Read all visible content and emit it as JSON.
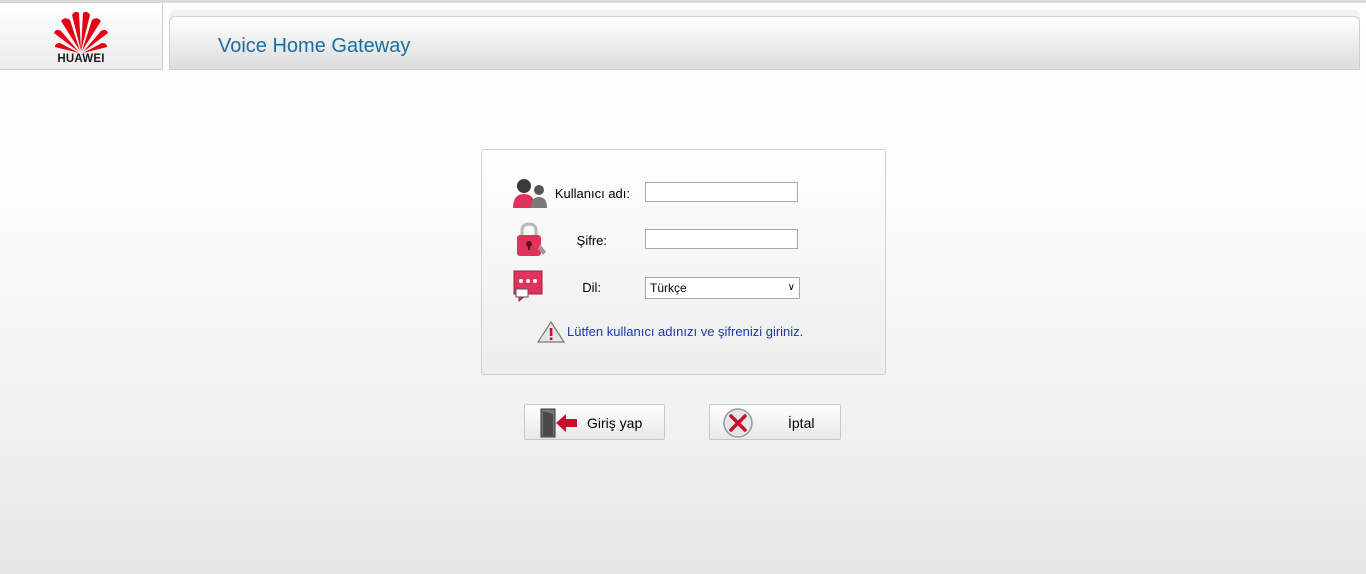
{
  "brand": {
    "logo_text": "HUAWEI",
    "logo_color": "#e60012"
  },
  "header": {
    "title": "Voice Home Gateway",
    "title_color": "#1a6fa0"
  },
  "login": {
    "username_label": "Kullanıcı adı:",
    "username_value": "",
    "password_label": "Şifre:",
    "password_value": "",
    "language_label": "Dil:",
    "language_selected": "Türkçe",
    "hint_text": "Lütfen kullanıcı adınızı ve şifrenizi giriniz.",
    "icons": {
      "user": "user-icon",
      "password": "lock-icon",
      "language": "chat-bubble-icon",
      "warning": "warning-icon"
    }
  },
  "actions": {
    "login_label": "Giriş yap",
    "cancel_label": "İptal",
    "icons": {
      "login": "door-enter-icon",
      "cancel": "close-circle-icon"
    }
  }
}
